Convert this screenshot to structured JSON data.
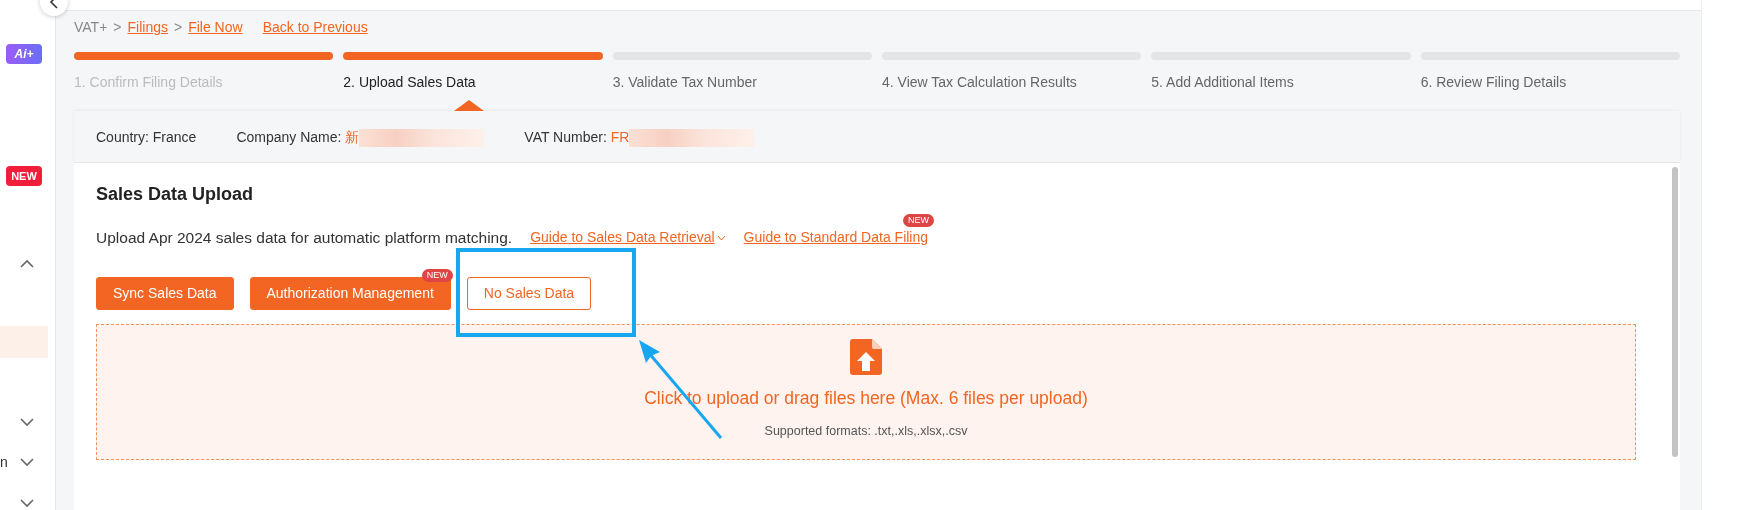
{
  "sidebar": {
    "items": [
      {
        "kind": "ai-badge",
        "label": "Ai+"
      },
      {
        "kind": "new-badge",
        "label": "NEW"
      },
      {
        "kind": "chevron",
        "expanded": true
      },
      {
        "kind": "highlight",
        "selected": true
      },
      {
        "kind": "chevron",
        "expanded": false
      },
      {
        "kind": "chevron",
        "expanded": false,
        "label": "n"
      },
      {
        "kind": "chevron",
        "expanded": false
      }
    ]
  },
  "breadcrumb": {
    "items": [
      {
        "kind": "crumb",
        "label": "VAT+",
        "link": false
      },
      {
        "kind": "separator",
        "label": ">"
      },
      {
        "kind": "crumb",
        "label": "Filings",
        "link": true
      },
      {
        "kind": "separator",
        "label": ">"
      },
      {
        "kind": "crumb",
        "label": "File Now",
        "link": true
      }
    ],
    "back": "Back to Previous"
  },
  "steps": [
    {
      "label": "1. Confirm Filing Details",
      "reached": true,
      "completed": true,
      "current": false
    },
    {
      "label": "2. Upload Sales Data",
      "reached": true,
      "completed": false,
      "current": true
    },
    {
      "label": "3. Validate Tax Number",
      "reached": false,
      "completed": false,
      "current": false
    },
    {
      "label": "4. View Tax Calculation Results",
      "reached": false,
      "completed": false,
      "current": false
    },
    {
      "label": "5. Add Additional Items",
      "reached": false,
      "completed": false,
      "current": false
    },
    {
      "label": "6. Review Filing Details",
      "reached": false,
      "completed": false,
      "current": false
    }
  ],
  "info": [
    {
      "label": "Country:",
      "value": "France"
    },
    {
      "label": "Company Name:",
      "value": "新",
      "redacted": true
    },
    {
      "label": "VAT Number:",
      "value": "FR",
      "redacted": true
    }
  ],
  "section": {
    "title": "Sales Data Upload",
    "description": "Upload Apr 2024 sales data for automatic platform matching.",
    "links": [
      {
        "label": "Guide to Sales Data Retrieval",
        "dropdown": true
      },
      {
        "label": "Guide to Standard Data Filing",
        "badge": "NEW"
      }
    ],
    "buttons": [
      {
        "label": "Sync Sales Data",
        "kind": "primary"
      },
      {
        "label": "Authorization Management",
        "kind": "primary",
        "badge": "NEW"
      },
      {
        "label": "No Sales Data",
        "kind": "outline"
      }
    ],
    "upload": {
      "prompt": "Click to upload or drag files here (Max. 6 files per upload)",
      "formats": "Supported formats: .txt,.xls,.xlsx,.csv"
    }
  },
  "annotation": {
    "highlight": true,
    "arrow": true
  }
}
